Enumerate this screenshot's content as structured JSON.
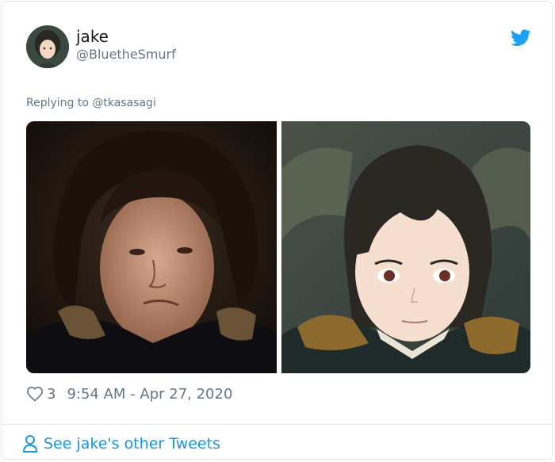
{
  "tweet": {
    "display_name": "jake",
    "handle": "@BluetheSmurf",
    "replying_to": "Replying to @tkasasagi",
    "like_count": "3",
    "timestamp": "9:54 AM - Apr 27, 2020",
    "photos": [
      {
        "name": "photo-selfie"
      },
      {
        "name": "photo-anime-portrait"
      }
    ]
  },
  "footer": {
    "see_more_label": "See jake's other Tweets"
  },
  "colors": {
    "twitter_blue": "#1da1f2",
    "link_blue": "#1b95e0",
    "secondary_text": "#657786",
    "divider": "#e1e8ed"
  },
  "icons": {
    "logo": "twitter-bird-icon",
    "like": "heart-outline-icon",
    "profile": "person-outline-icon"
  }
}
